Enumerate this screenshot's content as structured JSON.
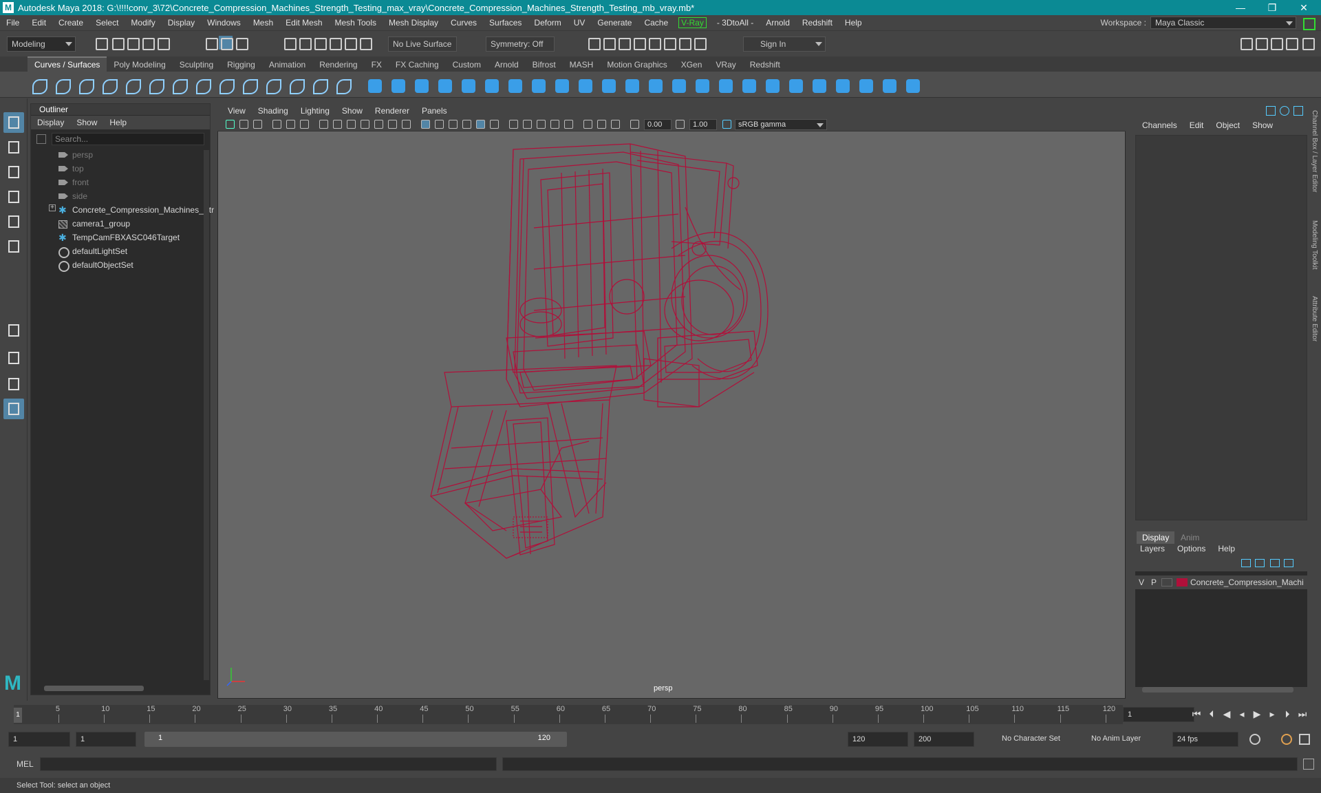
{
  "titlebar": {
    "title": "Autodesk Maya 2018: G:\\!!!!conv_3\\72\\Concrete_Compression_Machines_Strength_Testing_max_vray\\Concrete_Compression_Machines_Strength_Testing_mb_vray.mb*",
    "minimize": "—",
    "maximize": "❐",
    "close": "✕"
  },
  "menubar": [
    "File",
    "Edit",
    "Create",
    "Select",
    "Modify",
    "Display",
    "Windows",
    "Mesh",
    "Edit Mesh",
    "Mesh Tools",
    "Mesh Display",
    "Curves",
    "Surfaces",
    "Deform",
    "UV",
    "Generate",
    "Cache",
    "V-Ray",
    "- 3DtoAll -",
    "Arnold",
    "Redshift",
    "Help"
  ],
  "workspace": {
    "label": "Workspace :",
    "value": "Maya Classic"
  },
  "statusline": {
    "mode": "Modeling",
    "live_surface": "No Live Surface",
    "symmetry": "Symmetry: Off",
    "sign_in": "Sign In"
  },
  "shelf_tabs": [
    "Curves / Surfaces",
    "Poly Modeling",
    "Sculpting",
    "Rigging",
    "Animation",
    "Rendering",
    "FX",
    "FX Caching",
    "Custom",
    "Arnold",
    "Bifrost",
    "MASH",
    "Motion Graphics",
    "XGen",
    "VRay",
    "Redshift"
  ],
  "outliner": {
    "title": "Outliner",
    "menu": [
      "Display",
      "Show",
      "Help"
    ],
    "search_placeholder": "Search...",
    "items": [
      {
        "label": "persp",
        "icon": "camera-icon",
        "dim": true
      },
      {
        "label": "top",
        "icon": "camera-icon",
        "dim": true
      },
      {
        "label": "front",
        "icon": "camera-icon",
        "dim": true
      },
      {
        "label": "side",
        "icon": "camera-icon",
        "dim": true
      },
      {
        "label": "Concrete_Compression_Machines_Str",
        "icon": "transform-icon",
        "expand": "+"
      },
      {
        "label": "camera1_group",
        "icon": "group-icon"
      },
      {
        "label": "TempCamFBXASC046Target",
        "icon": "transform-icon"
      },
      {
        "label": "defaultLightSet",
        "icon": "set-icon"
      },
      {
        "label": "defaultObjectSet",
        "icon": "set-icon"
      }
    ]
  },
  "viewport": {
    "menu": [
      "View",
      "Shading",
      "Lighting",
      "Show",
      "Renderer",
      "Panels"
    ],
    "exposure": "0.00",
    "gamma": "1.00",
    "color_space": "sRGB gamma",
    "camera_label": "persp",
    "wire_color": "#b0103a"
  },
  "channelbox": {
    "menu": [
      "Channels",
      "Edit",
      "Object",
      "Show"
    ]
  },
  "layers": {
    "tabs": [
      "Display",
      "Anim"
    ],
    "menu": [
      "Layers",
      "Options",
      "Help"
    ],
    "layer": {
      "v": "V",
      "p": "P",
      "name": "Concrete_Compression_Machin",
      "color": "#b0103a"
    }
  },
  "side_tabs": [
    "Channel Box / Layer Editor",
    "Modeling Toolkit",
    "Attribute Editor"
  ],
  "timeslider": {
    "ticks": [
      "5",
      "10",
      "15",
      "20",
      "25",
      "30",
      "35",
      "40",
      "45",
      "50",
      "55",
      "60",
      "65",
      "70",
      "75",
      "80",
      "85",
      "90",
      "95",
      "100",
      "105",
      "110",
      "115",
      "120"
    ],
    "start_marker": "1",
    "current_frame": "1"
  },
  "range": {
    "start": "1",
    "playback_start": "1",
    "slider_start": "1",
    "slider_end": "120",
    "playback_end": "120",
    "end": "200",
    "character_set": "No Character Set",
    "anim_layer": "No Anim Layer",
    "fps": "24 fps"
  },
  "cmdline": {
    "lang": "MEL"
  },
  "helpline": {
    "text": "Select Tool: select an object"
  }
}
